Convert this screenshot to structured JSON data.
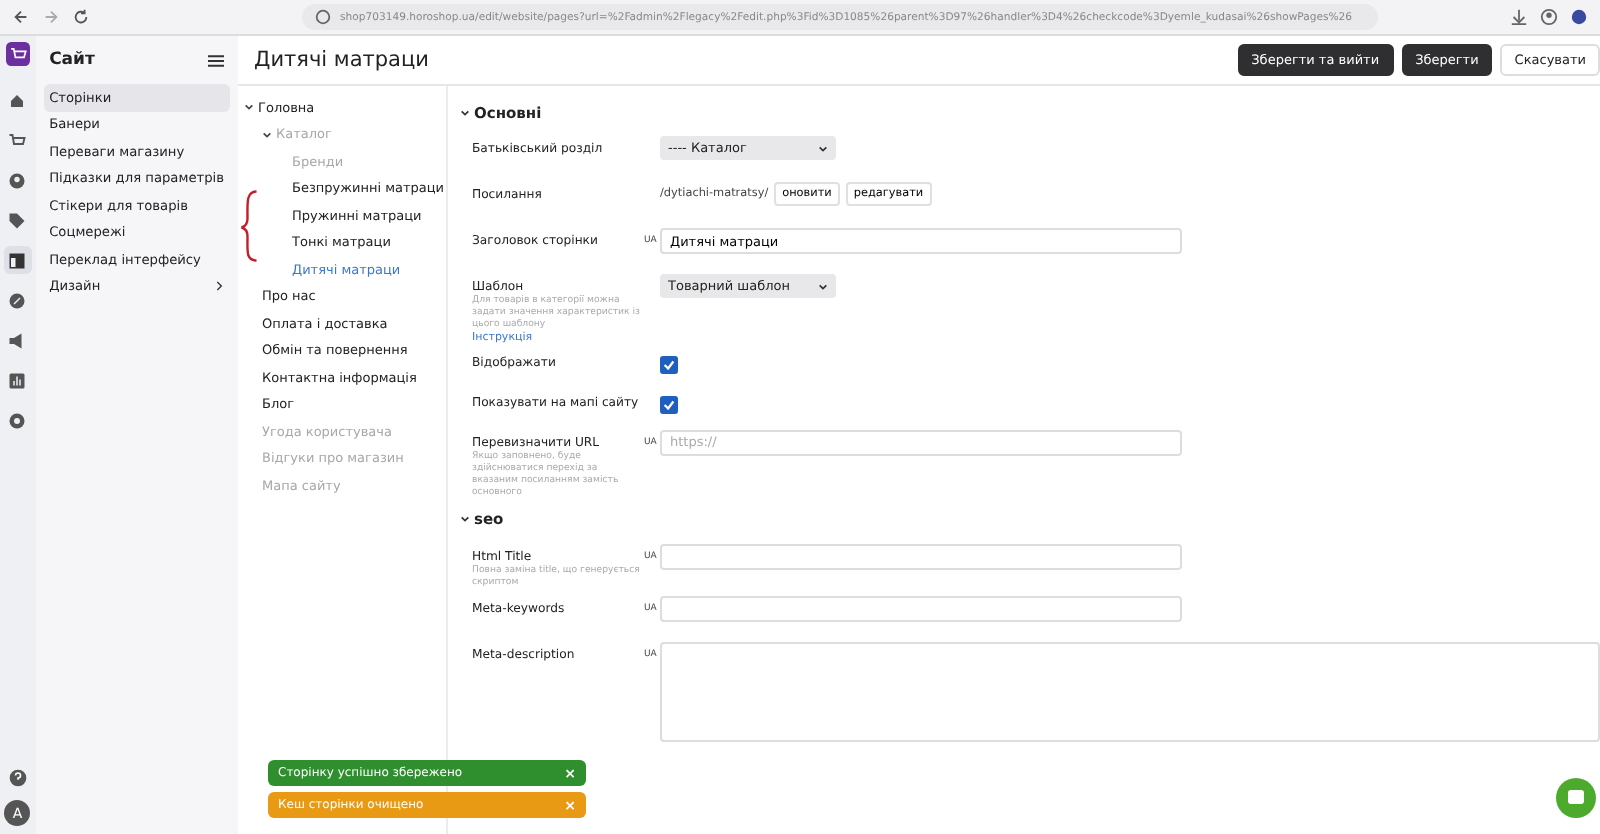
{
  "browser": {
    "url": "shop703149.horoshop.ua/edit/website/pages?url=%2Fadmin%2Flegacy%2Fedit.php%3Fid%3D1085%26parent%3D97%26handler%3D4%26checkcode%3Dyemle_kudasai%26showPages%26"
  },
  "rail": {
    "items": [
      {
        "selected": false
      },
      {
        "selected": false
      },
      {
        "selected": false
      },
      {
        "selected": false
      },
      {
        "selected": true
      },
      {
        "selected": false
      },
      {
        "selected": false
      },
      {
        "selected": false
      },
      {
        "selected": false
      }
    ],
    "avatar": "A"
  },
  "sidebar": {
    "title": "Сайт",
    "items": [
      {
        "label": "Сторінки",
        "selected": true,
        "has_submenu": false
      },
      {
        "label": "Банери",
        "selected": false,
        "has_submenu": false
      },
      {
        "label": "Переваги магазину",
        "selected": false,
        "has_submenu": false
      },
      {
        "label": "Підказки для параметрів",
        "selected": false,
        "has_submenu": false
      },
      {
        "label": "Стікери для товарів",
        "selected": false,
        "has_submenu": false
      },
      {
        "label": "Соцмережі",
        "selected": false,
        "has_submenu": false
      },
      {
        "label": "Переклад інтерфейсу",
        "selected": false,
        "has_submenu": false
      },
      {
        "label": "Дизайн",
        "selected": false,
        "has_submenu": true
      }
    ]
  },
  "page": {
    "title": "Дитячі матраци",
    "buttons": [
      {
        "label": "Зберегти та вийти",
        "kind": "dark"
      },
      {
        "label": "Зберегти",
        "kind": "dark"
      },
      {
        "label": "Скасувати",
        "kind": "light"
      }
    ]
  },
  "tree": [
    {
      "label": "Головна",
      "expanded": true,
      "hidden": false,
      "selected": false,
      "children": [
        {
          "label": "Каталог",
          "expanded": true,
          "hidden": true,
          "selected": false,
          "children": [
            {
              "label": "Бренди",
              "hidden": true,
              "selected": false
            },
            {
              "label": "Безпружинні матраци",
              "hidden": false,
              "selected": false
            },
            {
              "label": "Пружинні матраци",
              "hidden": false,
              "selected": false
            },
            {
              "label": "Тонкі матраци",
              "hidden": false,
              "selected": false
            },
            {
              "label": "Дитячі матраци",
              "hidden": false,
              "selected": true
            }
          ]
        },
        {
          "label": "Про нас",
          "hidden": false,
          "selected": false
        },
        {
          "label": "Оплата і доставка",
          "hidden": false,
          "selected": false
        },
        {
          "label": "Обмін та повернення",
          "hidden": false,
          "selected": false
        },
        {
          "label": "Контактна інформація",
          "hidden": false,
          "selected": false
        },
        {
          "label": "Блог",
          "hidden": false,
          "selected": false
        },
        {
          "label": "Угода користувача",
          "hidden": true,
          "selected": false
        },
        {
          "label": "Відгуки про магазин",
          "hidden": true,
          "selected": false
        },
        {
          "label": "Мапа сайту",
          "hidden": true,
          "selected": false
        }
      ]
    }
  ],
  "sections": [
    {
      "title": "Основні",
      "expanded": true,
      "fields": [
        {
          "kind": "select",
          "label": "Батьківський розділ",
          "value": "---- Каталог"
        },
        {
          "kind": "link",
          "label": "Посилання",
          "value": "/dytiachi-matratsy/",
          "buttons": [
            "оновити",
            "редагувати"
          ]
        },
        {
          "kind": "text",
          "label": "Заголовок сторінки",
          "lang": "UA",
          "value": "Дитячі матраци"
        },
        {
          "kind": "select",
          "label": "Шаблон",
          "hint": "Для товарів в категорії можна задати значення характеристик із цього шаблону",
          "link": "Інструкція",
          "value": "Товарний шаблон"
        },
        {
          "kind": "checkbox",
          "label": "Відображати",
          "checked": true
        },
        {
          "kind": "checkbox",
          "label": "Показувати на мапі сайту",
          "checked": true
        },
        {
          "kind": "text",
          "label": "Перевизначити URL",
          "hint": "Якщо заповнено, буде здійснюватися перехід за вказаним посиланням замість основного",
          "lang": "UA",
          "placeholder": "https://"
        }
      ]
    },
    {
      "title": "seo",
      "expanded": true,
      "fields": [
        {
          "kind": "text",
          "label": "Html Title",
          "hint": "Повна заміна title, що генерується скриптом",
          "lang": "UA"
        },
        {
          "kind": "text",
          "label": "Meta-keywords",
          "lang": "UA"
        },
        {
          "kind": "textarea",
          "label": "Meta-description",
          "lang": "UA"
        }
      ]
    }
  ],
  "toasts": [
    {
      "text": "Сторінку успішно збережено",
      "color": "#2f8f2f",
      "close": "×"
    },
    {
      "text": "Кеш сторінки очищено",
      "color": "#e89a14",
      "close": "×"
    }
  ]
}
